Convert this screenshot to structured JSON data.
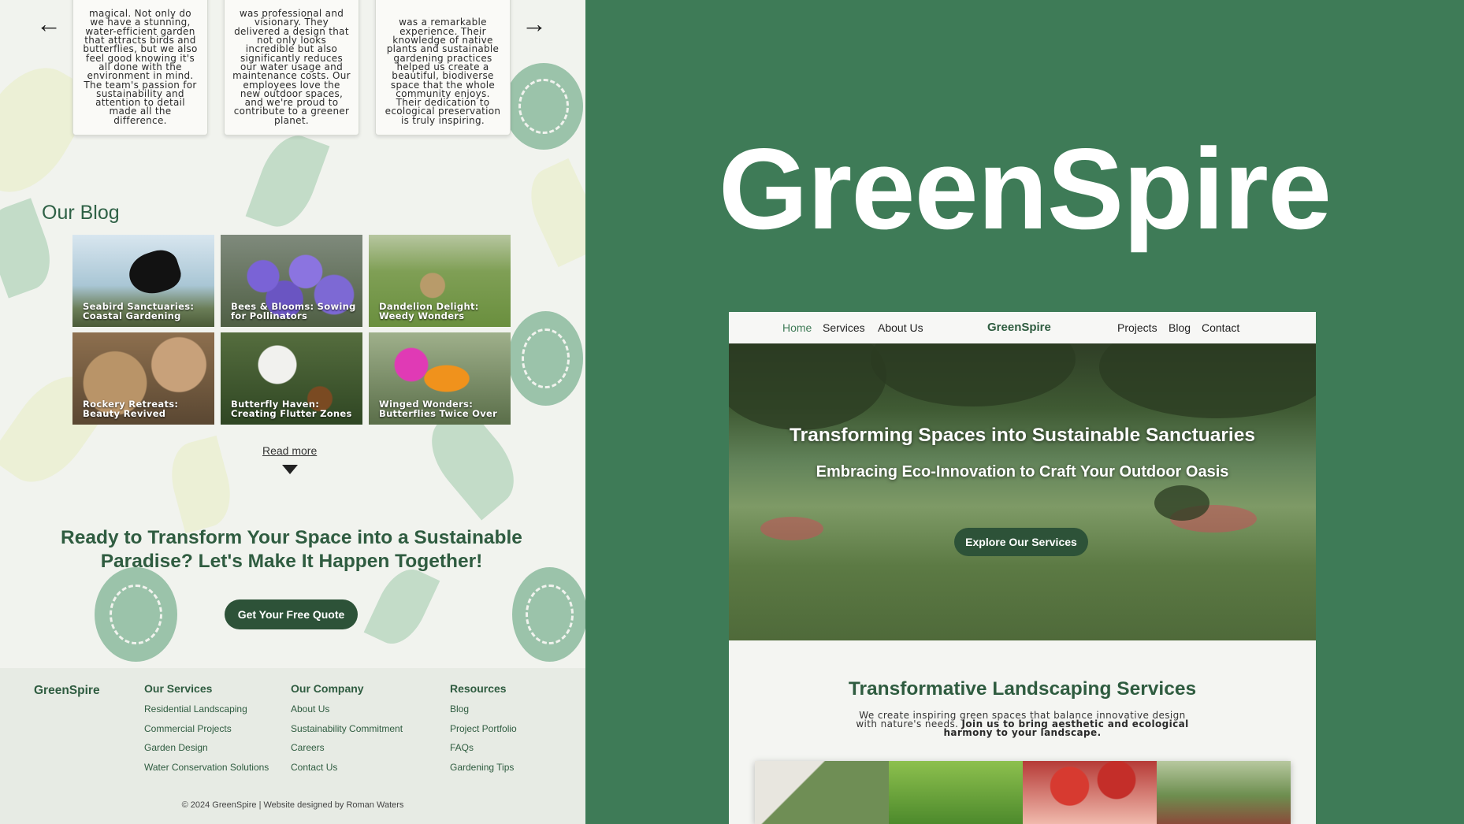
{
  "left_panel": {
    "nav": {
      "prev_icon": "arrow-left-icon",
      "next_icon": "arrow-right-icon"
    },
    "testimonials": [
      "magical. Not only do we have a stunning, water-efficient garden that attracts birds and butterflies, but we also feel good knowing it's all done with the environment in mind. The team's passion for sustainability and attention to detail made all the difference.",
      "was professional and visionary. They delivered a design that not only looks incredible but also significantly reduces our water usage and maintenance costs. Our employees love the new outdoor spaces, and we're proud to contribute to a greener planet.",
      "was a remarkable experience. Their knowledge of native plants and sustainable gardening practices helped us create a beautiful, biodiverse space that the whole community enjoys. Their dedication to ecological preservation is truly inspiring."
    ],
    "blog": {
      "title": "Our Blog",
      "posts": [
        {
          "title": "Seabird Sanctuaries: Coastal Gardening"
        },
        {
          "title": "Bees & Blooms: Sowing for Pollinators"
        },
        {
          "title": "Dandelion Delight: Weedy Wonders"
        },
        {
          "title": "Rockery Retreats: Beauty Revived"
        },
        {
          "title": "Butterfly Haven: Creating Flutter Zones"
        },
        {
          "title": "Winged Wonders: Butterflies Twice Over"
        }
      ],
      "read_more": "Read more"
    },
    "cta": {
      "heading": "Ready to Transform Your Space into a Sustainable Paradise? Let's Make It Happen Together!",
      "button": "Get Your Free Quote"
    },
    "footer": {
      "brand": "GreenSpire",
      "columns": [
        {
          "title": "Our Services",
          "links": [
            "Residential Landscaping",
            "Commercial Projects",
            "Garden Design",
            "Water Conservation Solutions"
          ]
        },
        {
          "title": "Our Company",
          "links": [
            "About Us",
            "Sustainability Commitment",
            "Careers",
            "Contact Us"
          ]
        },
        {
          "title": "Resources",
          "links": [
            "Blog",
            "Project Portfolio",
            "FAQs",
            "Gardening Tips"
          ]
        }
      ],
      "copyright": "© 2024 GreenSpire | Website designed by Roman Waters"
    }
  },
  "right_panel": {
    "brand_title": "GreenSpire",
    "preview": {
      "nav": {
        "left_links": [
          "Home",
          "Services",
          "About Us"
        ],
        "brand": "GreenSpire",
        "right_links": [
          "Projects",
          "Blog",
          "Contact"
        ]
      },
      "hero": {
        "heading": "Transforming Spaces into Sustainable Sanctuaries",
        "subheading": "Embracing Eco-Innovation to Craft Your Outdoor Oasis",
        "button": "Explore Our Services"
      },
      "services": {
        "title": "Transformative Landscaping Services",
        "description_plain": "We create inspiring green spaces that balance innovative design with nature's needs.",
        "description_bold": "Join us to bring aesthetic and ecological harmony to your landscape."
      }
    }
  },
  "colors": {
    "background_green": "#3e7b57",
    "dark_green": "#2d5238",
    "text_green": "#2f5c40",
    "active_link": "#3f7b57",
    "panel_light": "#f1f3ee"
  }
}
